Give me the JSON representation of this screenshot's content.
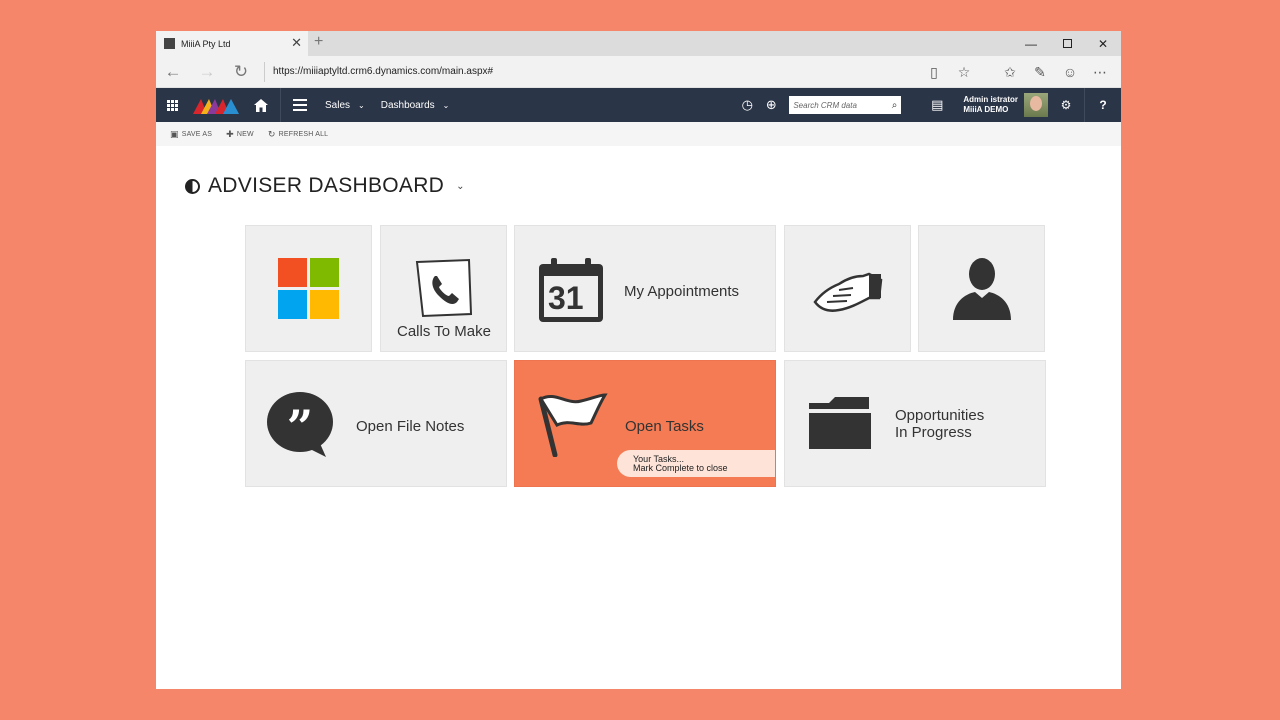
{
  "browser": {
    "tab_title": "MiiiA Pty Ltd",
    "tab_close": "✕",
    "new_tab": "+",
    "url": "https://miiiaptyltd.crm6.dynamics.com/main.aspx#",
    "window_controls": {
      "minimize": "—",
      "close": "✕"
    }
  },
  "crm_nav": {
    "items": [
      {
        "label": "Sales"
      },
      {
        "label": "Dashboards"
      }
    ],
    "search_placeholder": "Search CRM data",
    "user": {
      "name": "Admin istrator",
      "org": "MiiiA DEMO"
    },
    "help": "?"
  },
  "command_bar": {
    "save_as": "SAVE AS",
    "new": "NEW",
    "refresh_all": "REFRESH ALL"
  },
  "dashboard": {
    "title": "ADVISER DASHBOARD",
    "tiles": {
      "calls": "Calls To Make",
      "appointments": "My Appointments",
      "calendar_day": "31",
      "file_notes": "Open File Notes",
      "tasks": "Open Tasks",
      "opps_line1": "Opportunities",
      "opps_line2": "In Progress"
    },
    "tasks_tooltip": {
      "line1": "Your Tasks...",
      "line2": "Mark Complete to close"
    }
  },
  "colors": {
    "background": "#f5866a",
    "crm_bar": "#2b3548",
    "tasks_tile": "#f47b53",
    "ms_red": "#f25022",
    "ms_green": "#7fba00",
    "ms_blue": "#00a4ef",
    "ms_yellow": "#ffb900"
  }
}
